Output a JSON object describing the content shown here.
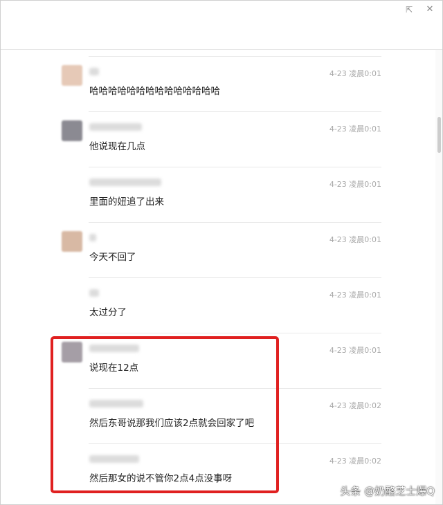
{
  "window": {
    "icons": {
      "share": "share-icon",
      "close": "close-icon"
    }
  },
  "messages": [
    {
      "time": "4-23 凌晨0:01",
      "text": "哈哈哈哈哈哈哈哈哈哈哈哈哈哈",
      "avatar": true,
      "avatar_color": "#e6c9b7"
    },
    {
      "time": "4-23 凌晨0:01",
      "text": "他说现在几点",
      "avatar": true,
      "avatar_color": "#8b8a92"
    },
    {
      "time": "4-23 凌晨0:01",
      "text": "里面的妞追了出来",
      "avatar": false,
      "avatar_color": ""
    },
    {
      "time": "4-23 凌晨0:01",
      "text": "今天不回了",
      "avatar": true,
      "avatar_color": "#d8b9a4"
    },
    {
      "time": "4-23 凌晨0:01",
      "text": "太过分了",
      "avatar": false,
      "avatar_color": ""
    },
    {
      "time": "4-23 凌晨0:01",
      "text": "说现在12点",
      "avatar": true,
      "avatar_color": "#a59ea6"
    },
    {
      "time": "4-23 凌晨0:02",
      "text": "然后东哥说那我们应该2点就会回家了吧",
      "avatar": false,
      "avatar_color": ""
    },
    {
      "time": "4-23 凌晨0:02",
      "text": "然后那女的说不管你2点4点没事呀",
      "avatar": false,
      "avatar_color": ""
    }
  ],
  "highlight_color": "#e02020",
  "watermark": "头条 @奶酪芝士爆Q"
}
